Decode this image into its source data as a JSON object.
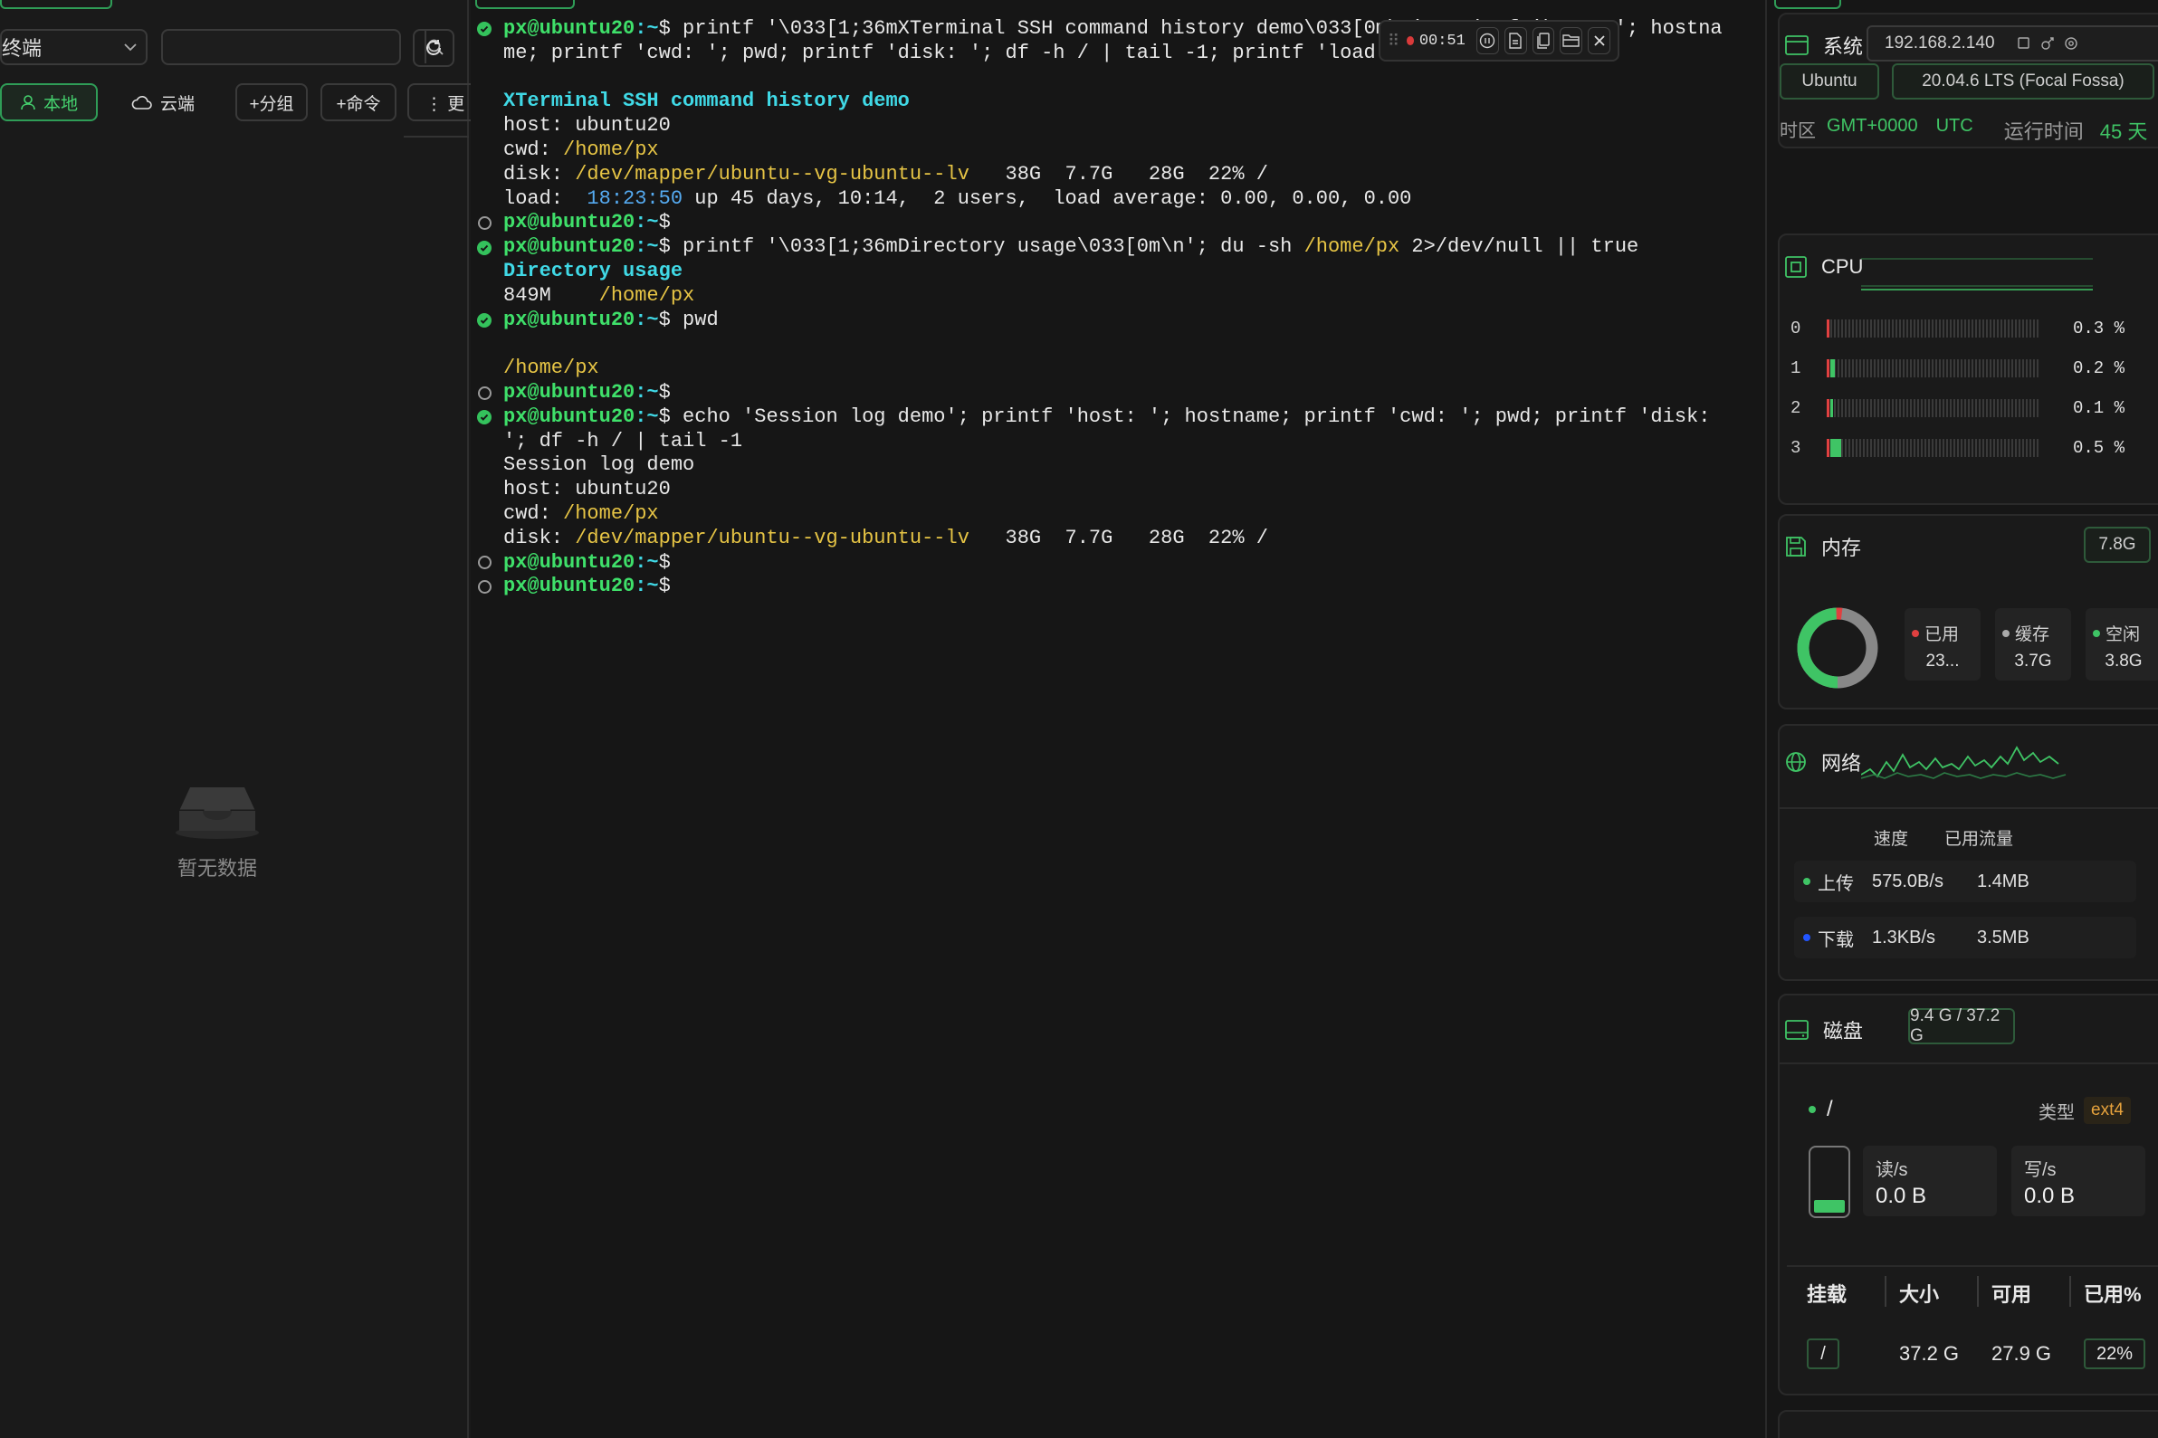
{
  "left": {
    "session_select": "终端",
    "search_placeholder": "",
    "buttons": {
      "local": "本地",
      "cloud": "云端",
      "add_group": "+分组",
      "add_command": "+命令",
      "more": "⋮ 更"
    },
    "empty_text": "暂无数据"
  },
  "terminal": {
    "timer": "00:51",
    "lines": [
      {
        "mark": "ok",
        "segs": [
          [
            "px@ubuntu20",
            "green"
          ],
          [
            ":~",
            "cyan"
          ],
          [
            "$ printf '\\033[1;36mXTerminal SSH command history demo\\033[0m\\n'; printf 'host: '; hostna",
            "white"
          ]
        ]
      },
      {
        "mark": "none",
        "segs": [
          [
            "me; printf 'cwd: '; pwd; printf 'disk: '; df -h / | tail -1; printf 'load",
            "white"
          ]
        ]
      },
      {
        "mark": "none",
        "segs": []
      },
      {
        "mark": "none",
        "segs": [
          [
            "XTerminal SSH command history demo",
            "cyan"
          ]
        ]
      },
      {
        "mark": "none",
        "segs": [
          [
            "host: ubuntu20",
            "white"
          ]
        ]
      },
      {
        "mark": "none",
        "segs": [
          [
            "cwd: ",
            "white"
          ],
          [
            "/home/px",
            "yellow"
          ]
        ]
      },
      {
        "mark": "none",
        "segs": [
          [
            "disk: ",
            "white"
          ],
          [
            "/dev/mapper/ubuntu--vg-ubuntu--lv",
            "yellow"
          ],
          [
            "   38G  7.7G   28G  22% /",
            "white"
          ]
        ]
      },
      {
        "mark": "none",
        "segs": [
          [
            "load:  ",
            "white"
          ],
          [
            "18:23:50",
            "blue"
          ],
          [
            " up 45 days, 10:14,  2 users,  load average: 0.00, 0.00, 0.00",
            "white"
          ]
        ]
      },
      {
        "mark": "idle",
        "segs": [
          [
            "px@ubuntu20",
            "green"
          ],
          [
            ":~",
            "cyan"
          ],
          [
            "$",
            "white"
          ]
        ]
      },
      {
        "mark": "ok",
        "segs": [
          [
            "px@ubuntu20",
            "green"
          ],
          [
            ":~",
            "cyan"
          ],
          [
            "$ printf '\\033[1;36mDirectory usage\\033[0m\\n'; du -sh ",
            "white"
          ],
          [
            "/home/px",
            "yellow"
          ],
          [
            " 2>/dev/null || true",
            "white"
          ]
        ]
      },
      {
        "mark": "none",
        "segs": [
          [
            "Directory usage",
            "cyan"
          ]
        ]
      },
      {
        "mark": "none",
        "segs": [
          [
            "849M    ",
            "white"
          ],
          [
            "/home/px",
            "yellow"
          ]
        ]
      },
      {
        "mark": "ok",
        "segs": [
          [
            "px@ubuntu20",
            "green"
          ],
          [
            ":~",
            "cyan"
          ],
          [
            "$ pwd",
            "white"
          ]
        ]
      },
      {
        "mark": "none",
        "segs": []
      },
      {
        "mark": "none",
        "segs": [
          [
            "/home/px",
            "yellow"
          ]
        ]
      },
      {
        "mark": "idle",
        "segs": [
          [
            "px@ubuntu20",
            "green"
          ],
          [
            ":~",
            "cyan"
          ],
          [
            "$",
            "white"
          ]
        ]
      },
      {
        "mark": "ok",
        "segs": [
          [
            "px@ubuntu20",
            "green"
          ],
          [
            ":~",
            "cyan"
          ],
          [
            "$ echo 'Session log demo'; printf 'host: '; hostname; printf 'cwd: '; pwd; printf 'disk:",
            "white"
          ]
        ]
      },
      {
        "mark": "none",
        "segs": [
          [
            "'; df -h / | tail -1",
            "white"
          ]
        ]
      },
      {
        "mark": "none",
        "segs": [
          [
            "Session log demo",
            "white"
          ]
        ]
      },
      {
        "mark": "none",
        "segs": [
          [
            "host: ubuntu20",
            "white"
          ]
        ]
      },
      {
        "mark": "none",
        "segs": [
          [
            "cwd: ",
            "white"
          ],
          [
            "/home/px",
            "yellow"
          ]
        ]
      },
      {
        "mark": "none",
        "segs": [
          [
            "disk: ",
            "white"
          ],
          [
            "/dev/mapper/ubuntu--vg-ubuntu--lv",
            "yellow"
          ],
          [
            "   38G  7.7G   28G  22% /",
            "white"
          ]
        ]
      },
      {
        "mark": "idle",
        "segs": [
          [
            "px@ubuntu20",
            "green"
          ],
          [
            ":~",
            "cyan"
          ],
          [
            "$",
            "white"
          ]
        ]
      },
      {
        "mark": "idle",
        "segs": [
          [
            "px@ubuntu20",
            "green"
          ],
          [
            ":~",
            "cyan"
          ],
          [
            "$",
            "white"
          ]
        ]
      }
    ]
  },
  "system": {
    "title": "系统",
    "ip": "192.168.2.140",
    "os": "Ubuntu",
    "version": "20.04.6 LTS (Focal Fossa)",
    "tz_label": "时区",
    "tz_value": "GMT+0000",
    "tz_name": "UTC",
    "uptime_label": "运行时间",
    "uptime_value": "45 天"
  },
  "cpu": {
    "title": "CPU",
    "cores": [
      {
        "idx": "0",
        "pct": "0.3 %",
        "level": 0.003
      },
      {
        "idx": "1",
        "pct": "0.2 %",
        "level": 0.002
      },
      {
        "idx": "2",
        "pct": "0.1 %",
        "level": 0.001
      },
      {
        "idx": "3",
        "pct": "0.5 %",
        "level": 0.005
      }
    ]
  },
  "memory": {
    "title": "内存",
    "total": "7.8G",
    "used_label": "已用",
    "used_value": "23...",
    "cache_label": "缓存",
    "cache_value": "3.7G",
    "free_label": "空闲",
    "free_value": "3.8G"
  },
  "network": {
    "title": "网络",
    "speed_header": "速度",
    "traffic_header": "已用流量",
    "upload_label": "上传",
    "upload_speed": "575.0B/s",
    "upload_total": "1.4MB",
    "download_label": "下载",
    "download_speed": "1.3KB/s",
    "download_total": "3.5MB"
  },
  "disk": {
    "title": "磁盘",
    "usage": "9.4 G / 37.2 G",
    "mount": "/",
    "type_label": "类型",
    "type_value": "ext4",
    "read_label": "读/s",
    "read_value": "0.0 B",
    "write_label": "写/s",
    "write_value": "0.0 B",
    "table_headers": [
      "挂载",
      "大小",
      "可用",
      "已用%"
    ],
    "row": {
      "mount": "/",
      "size": "37.2 G",
      "avail": "27.9 G",
      "used_pct": "22%"
    }
  },
  "colors": {
    "accent": "#3fc465",
    "prompt": "#3fe06a",
    "cyan": "#40d9e6",
    "path": "#e6c445",
    "record": "#d93a3a"
  }
}
